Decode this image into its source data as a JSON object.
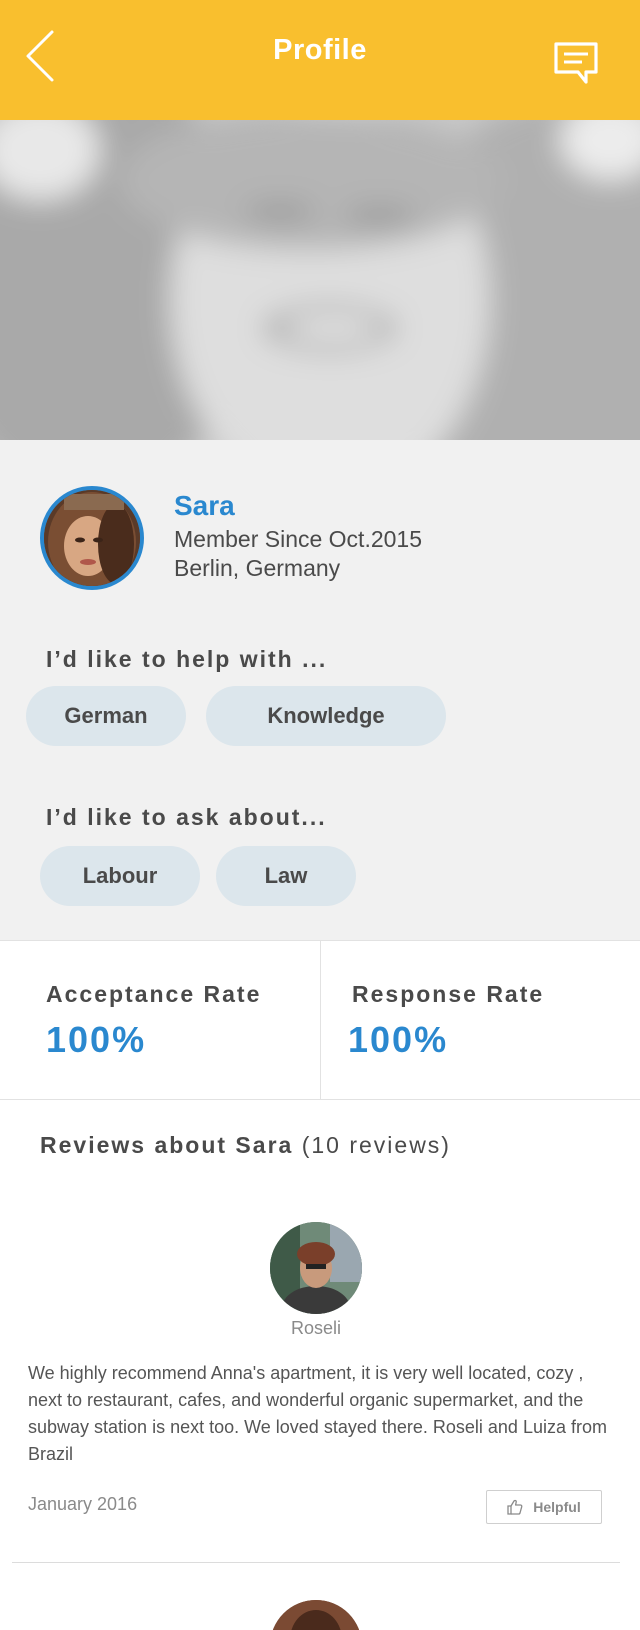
{
  "header": {
    "title": "Profile",
    "color": "#f9bf2e",
    "back_icon": "chevron-left-icon",
    "chat_icon": "message-icon"
  },
  "profile": {
    "name": "Sara",
    "member_since": "Member Since Oct.2015",
    "location": "Berlin, Germany",
    "accent_color": "#2a88cf"
  },
  "help": {
    "heading": "I’d like to help with ...",
    "tags": [
      "German",
      "Knowledge"
    ]
  },
  "ask": {
    "heading": "I’d like to ask about...",
    "tags": [
      "Labour",
      "Law"
    ]
  },
  "rates": {
    "acceptance_label": "Acceptance Rate",
    "acceptance_value": "100%",
    "response_label": "Response Rate",
    "response_value": "100%"
  },
  "reviews": {
    "heading": "Reviews about Sara",
    "count_text": "(10 reviews)",
    "items": [
      {
        "reviewer": "Roseli",
        "text": "We highly recommend Anna's apartment, it is very well located, cozy , next to restaurant, cafes, and wonderful organic supermarket, and the subway station is next too. We loved stayed there. Roseli and Luiza from Brazil",
        "date": "January 2016",
        "helpful_label": "Helpful",
        "helpful_icon": "thumbs-up-icon"
      }
    ]
  }
}
